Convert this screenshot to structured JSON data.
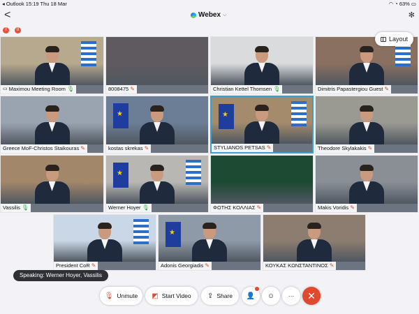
{
  "statusbar": {
    "left": "◂ Outlook  15:19  Thu 18 Mar",
    "right": "63%"
  },
  "app": {
    "back": "<",
    "title": "Webex",
    "title_chevron": "⌵",
    "bt": "✻"
  },
  "alerts": [
    "0",
    "0"
  ],
  "layout_button": "Layout",
  "tiles": [
    {
      "name": "Maximou Meeting Room",
      "mic": "on",
      "room": true,
      "bg": "#b7a98e"
    },
    {
      "name": "8008475",
      "mic": "muted",
      "room": false,
      "bg": "#5f5a5f"
    },
    {
      "name": "Christian Kettel Thomsen",
      "mic": "on",
      "room": false,
      "bg": "#d9dbdc"
    },
    {
      "name": "Dimitris Papastergiou Guest",
      "mic": "muted",
      "room": false,
      "bg": "#8a7060"
    },
    {
      "name": "Greece MoF-Christos Staikouras",
      "mic": "muted",
      "room": false,
      "bg": "#9aa4b1"
    },
    {
      "name": "kostas skrekas",
      "mic": "muted",
      "room": false,
      "bg": "#6b7e96"
    },
    {
      "name": "STYLIANOS PETSAS",
      "mic": "muted",
      "room": false,
      "bg": "#a48b6c",
      "active": true
    },
    {
      "name": "Theodore Skylakakis",
      "mic": "muted",
      "room": false,
      "bg": "#9a9a92"
    },
    {
      "name": "Vassilis",
      "mic": "on",
      "room": false,
      "bg": "#a2876a"
    },
    {
      "name": "Werner Hoyer",
      "mic": "on",
      "room": false,
      "bg": "#b8b7b4"
    },
    {
      "name": "ΦΩΤΗΣ ΚΟΛΛΙΑΣ",
      "mic": "muted",
      "room": false,
      "bg": "#1c4a33"
    },
    {
      "name": "Makis Voridis",
      "mic": "muted",
      "room": false,
      "bg": "#8a8f96"
    },
    {
      "name": "President CoR",
      "mic": "muted",
      "room": false,
      "bg": "#c9d7e6"
    },
    {
      "name": "Adonis Georgiadis",
      "mic": "muted",
      "room": false,
      "bg": "#8e9aa7"
    },
    {
      "name": "ΚΟΥΚΑΣ ΚΩΝΣΤΑΝΤΙΝΟΣ",
      "mic": "muted",
      "room": false,
      "bg": "#8c7d70"
    }
  ],
  "speaking": "Speaking: Werner Hoyer, Vassilis",
  "controls": {
    "unmute": "Unmute",
    "start_video": "Start Video",
    "share": "Share",
    "participants_icon": "participants-icon",
    "reactions_icon": "smiley-icon",
    "more": "···",
    "end": "✕"
  }
}
